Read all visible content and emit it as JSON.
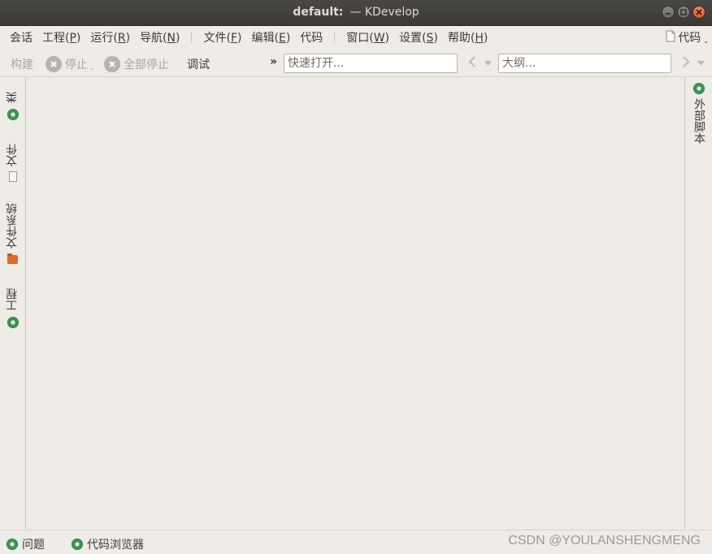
{
  "window": {
    "title": "default:",
    "app_name": "— KDevelop"
  },
  "menu": {
    "items": [
      {
        "label": "会话"
      },
      {
        "label": "工程(",
        "accel": "P",
        "suffix": ")"
      },
      {
        "label": "运行(",
        "accel": "R",
        "suffix": ")"
      },
      {
        "label": "导航(",
        "accel": "N",
        "suffix": ")"
      },
      {
        "label": "文件(",
        "accel": "F",
        "suffix": ")"
      },
      {
        "label": "编辑(",
        "accel": "E",
        "suffix": ")"
      },
      {
        "label": "代码"
      },
      {
        "label": "窗口(",
        "accel": "W",
        "suffix": ")"
      },
      {
        "label": "设置(",
        "accel": "S",
        "suffix": ")"
      },
      {
        "label": "帮助(",
        "accel": "H",
        "suffix": ")"
      }
    ],
    "right_label": "代码"
  },
  "toolbar": {
    "build_label": "构建",
    "stop_label": "停止",
    "stop_all_label": "全部停止",
    "debug_label": "调试",
    "overflow_label": "»",
    "quick_open_placeholder": "快速打开...",
    "outline_placeholder": "大纲..."
  },
  "left_dock": {
    "tabs": [
      {
        "label": "类",
        "icon": "class-gear-icon"
      },
      {
        "label": "文件",
        "icon": "document-icon"
      },
      {
        "label": "文件系统",
        "icon": "folder-icon"
      },
      {
        "label": "工程",
        "icon": "project-gear-icon"
      }
    ]
  },
  "right_dock": {
    "tabs": [
      {
        "label": "外部脚本",
        "icon": "script-gear-icon"
      }
    ]
  },
  "bottom_dock": {
    "tabs": [
      {
        "label": "问题",
        "icon": "problems-gear-icon"
      },
      {
        "label": "代码浏览器",
        "icon": "code-browser-gear-icon"
      }
    ]
  },
  "watermark": "CSDN @YOULANSHENGMENG",
  "colors": {
    "titlebar": "#3b3a36",
    "window_bg": "#efebe7",
    "icon_green": "#2e9a4a",
    "folder_orange": "#e06a2a",
    "close_button": "#e0552a"
  }
}
